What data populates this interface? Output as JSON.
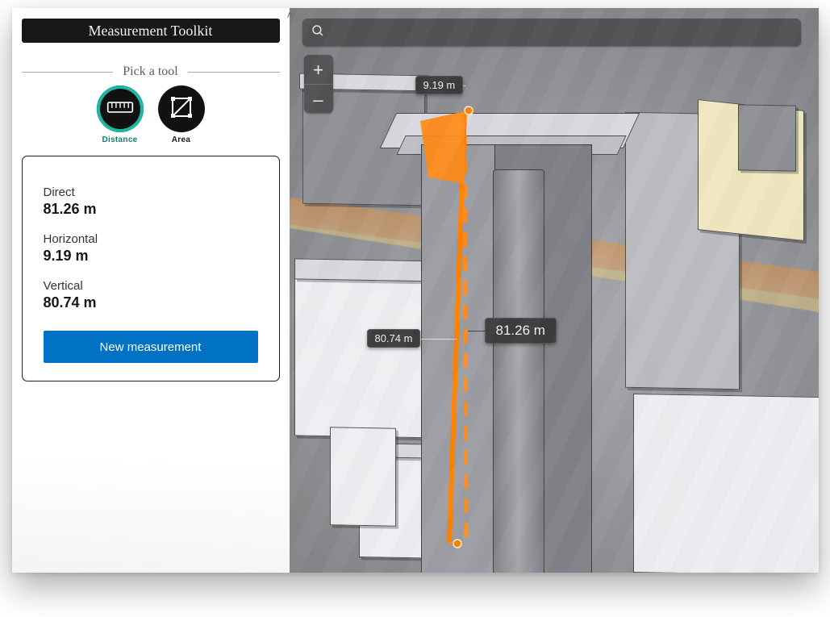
{
  "panel": {
    "title": "Measurement Toolkit",
    "picker_legend": "Pick a tool",
    "tools": {
      "distance": "Distance",
      "area": "Area"
    },
    "measurements": {
      "direct": {
        "label": "Direct",
        "value": "81.26 m"
      },
      "horizontal": {
        "label": "Horizontal",
        "value": "9.19 m"
      },
      "vertical": {
        "label": "Vertical",
        "value": "80.74 m"
      }
    },
    "new_button": "New measurement"
  },
  "scene": {
    "search_placeholder": "",
    "zoom_in": "+",
    "zoom_out": "–",
    "labels": {
      "top": "9.19 m",
      "height": "80.74 m",
      "direct": "81.26 m"
    }
  },
  "colors": {
    "accent": "#ff8000",
    "teal": "#1bb9a5",
    "primary": "#0072c6"
  }
}
